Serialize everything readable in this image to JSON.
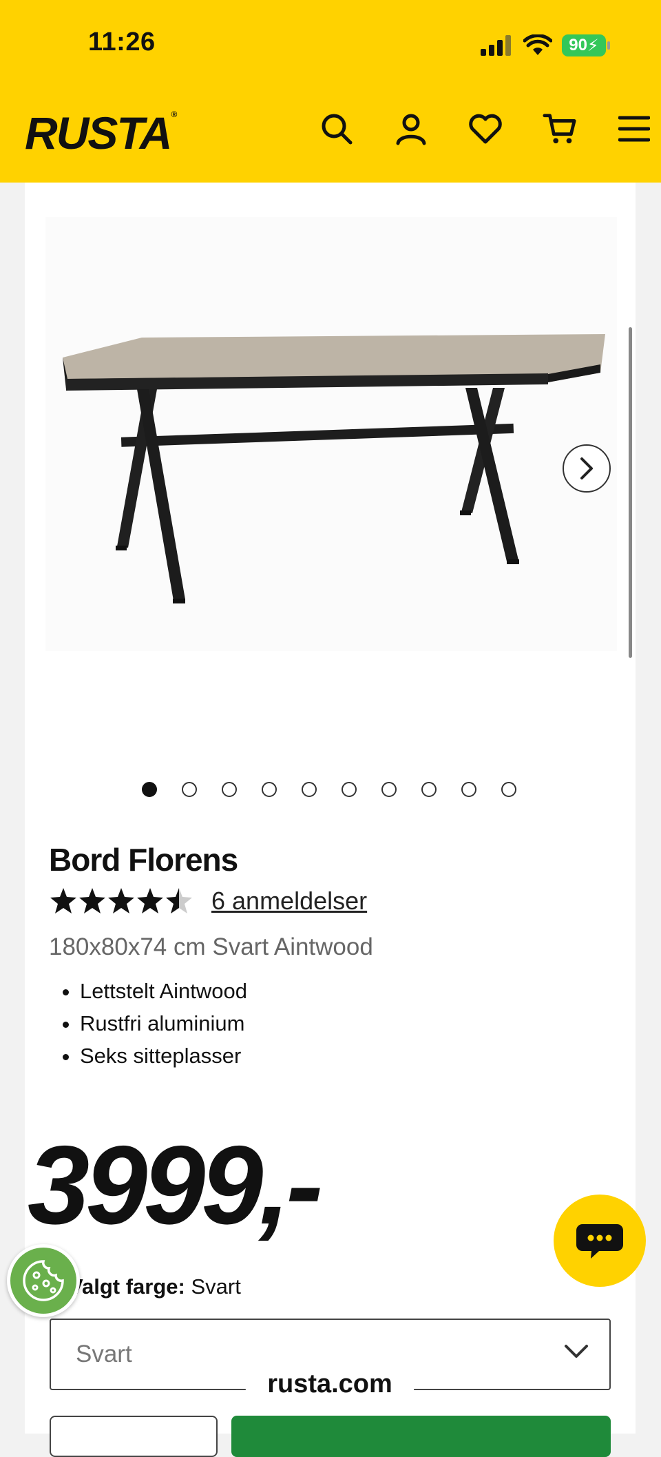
{
  "status_bar": {
    "time": "11:26",
    "battery": "90"
  },
  "header": {
    "logo": "RUSTA"
  },
  "product": {
    "title": "Bord Florens",
    "rating": 4.5,
    "reviews_link": "6 anmeldelser",
    "subtitle": "180x80x74 cm Svart Aintwood",
    "features": [
      "Lettstelt Aintwood",
      "Rustfri aluminium",
      "Seks sitteplasser"
    ],
    "price": "3999,-",
    "color_label": "Valgt farge:",
    "color_value": "Svart",
    "select_value": "Svart"
  },
  "gallery": {
    "image_count": 10,
    "active_index": 0
  },
  "browser": {
    "url": "rusta.com"
  },
  "colors": {
    "brand_yellow": "#ffd200",
    "cta_green": "#1f8a3a"
  }
}
